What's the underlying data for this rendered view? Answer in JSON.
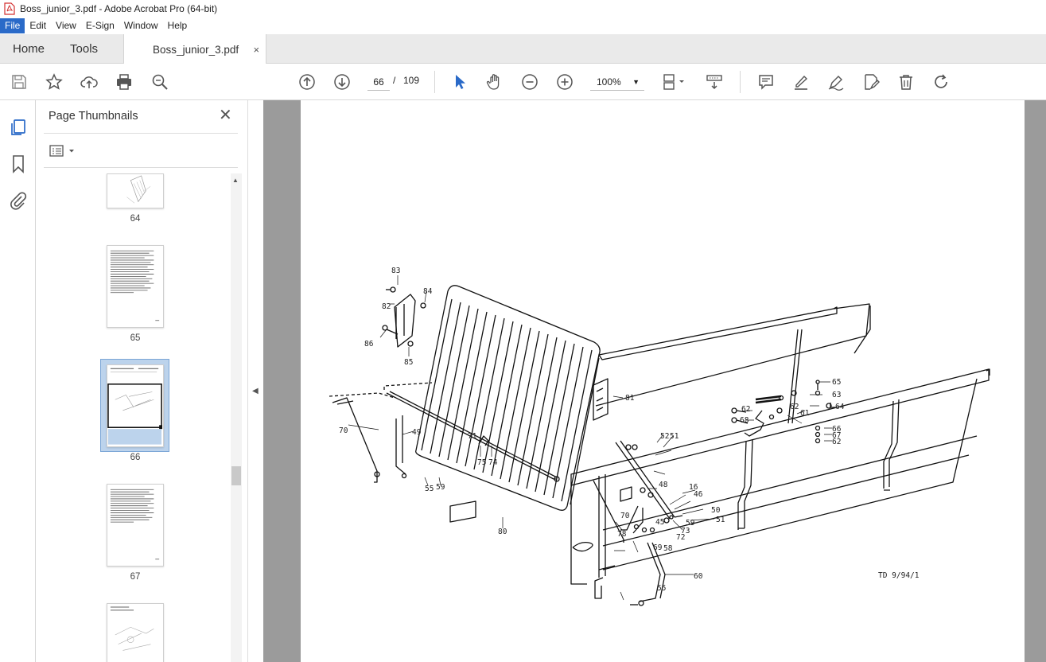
{
  "window": {
    "title": "Boss_junior_3.pdf - Adobe Acrobat Pro (64-bit)"
  },
  "menu": {
    "items": [
      "File",
      "Edit",
      "View",
      "E-Sign",
      "Window",
      "Help"
    ]
  },
  "tabs": {
    "home": "Home",
    "tools": "Tools",
    "document": "Boss_junior_3.pdf",
    "close": "×"
  },
  "toolbar": {
    "current_page": "66",
    "page_sep": "/",
    "total_pages": "109",
    "zoom": "100%"
  },
  "panel": {
    "title": "Page Thumbnails",
    "close": "✕",
    "thumbnails": [
      {
        "label": "64"
      },
      {
        "label": "65"
      },
      {
        "label": "66",
        "selected": true
      },
      {
        "label": "67"
      }
    ]
  },
  "drawing": {
    "callouts": [
      "83",
      "84",
      "82",
      "86",
      "85",
      "81",
      "70",
      "49",
      "71",
      "75",
      "74",
      "55",
      "59",
      "80",
      "52",
      "51",
      "48",
      "16",
      "46",
      "50",
      "51",
      "78",
      "69",
      "58",
      "45",
      "72",
      "73",
      "70",
      "60",
      "55",
      "65",
      "63",
      "62",
      "61",
      "64",
      "68",
      "66",
      "67",
      "62",
      "62",
      "59"
    ],
    "reference": "TD 9/94/1"
  }
}
